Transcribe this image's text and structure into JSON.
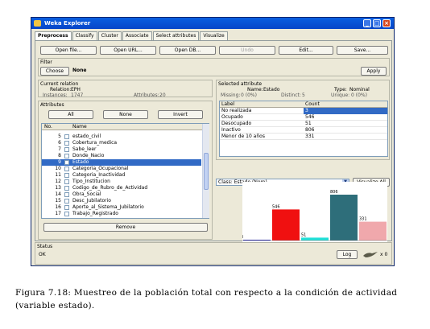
{
  "window": {
    "title": "Weka Explorer",
    "buttons": [
      "_",
      "□",
      "×"
    ]
  },
  "tabs": [
    "Preprocess",
    "Classify",
    "Cluster",
    "Associate",
    "Select attributes",
    "Visualize"
  ],
  "toolbar": {
    "open_file": "Open file...",
    "open_url": "Open URL...",
    "open_db": "Open DB...",
    "undo": "Undo",
    "edit": "Edit...",
    "save": "Save..."
  },
  "filter": {
    "title": "Filter",
    "choose": "Choose",
    "value": "None",
    "apply": "Apply"
  },
  "current_relation": {
    "title": "Current relation",
    "relation_label": "Relation:",
    "relation_value": "EPH",
    "instances_label": "Instances:",
    "instances_value": "1747",
    "attributes_label": "Attributes:",
    "attributes_value": "20"
  },
  "attributes": {
    "title": "Attributes",
    "buttons": {
      "all": "All",
      "none": "None",
      "invert": "Invert"
    },
    "header": {
      "no": "No.",
      "name": "Name"
    },
    "rows": [
      {
        "no": "5",
        "name": "estado_civil",
        "selected": false
      },
      {
        "no": "6",
        "name": "Cobertura_medica",
        "selected": false
      },
      {
        "no": "7",
        "name": "Sabe_leer",
        "selected": false
      },
      {
        "no": "8",
        "name": "Donde_Nacio",
        "selected": false
      },
      {
        "no": "9",
        "name": "Estado",
        "selected": true
      },
      {
        "no": "10",
        "name": "Categoria_Ocupacional",
        "selected": false
      },
      {
        "no": "11",
        "name": "Categoria_Inactividad",
        "selected": false
      },
      {
        "no": "12",
        "name": "Tipo_Institucion",
        "selected": false
      },
      {
        "no": "13",
        "name": "Codigo_de_Rubro_de_Actividad",
        "selected": false
      },
      {
        "no": "14",
        "name": "Obra_Social",
        "selected": false
      },
      {
        "no": "15",
        "name": "Desc_Jubilatorio",
        "selected": false
      },
      {
        "no": "16",
        "name": "Aporte_al_Sistema_Jubilatorio",
        "selected": false
      },
      {
        "no": "17",
        "name": "Trabajo_Registrado",
        "selected": false
      }
    ],
    "remove": "Remove"
  },
  "selected_attribute": {
    "title": "Selected attribute",
    "name_label": "Name:",
    "name_value": "Estado",
    "type_label": "Type:",
    "type_value": "Nominal",
    "missing_label": "Missing:",
    "missing_value": "0 (0%)",
    "distinct_label": "Distinct:",
    "distinct_value": "5",
    "unique_label": "Unique:",
    "unique_value": "0 (0%)",
    "table_header": {
      "label": "Label",
      "count": "Count"
    },
    "table_rows": [
      {
        "label": "No realizada",
        "count": "3",
        "selected": true
      },
      {
        "label": "Ocupado",
        "count": "546",
        "selected": false
      },
      {
        "label": "Desocupado",
        "count": "51",
        "selected": false
      },
      {
        "label": "Inactivo",
        "count": "806",
        "selected": false
      },
      {
        "label": "Menor de 10 años",
        "count": "331",
        "selected": false
      }
    ]
  },
  "class_select": {
    "value": "Class: Estado (Nom)",
    "visualize_all": "Visualize All"
  },
  "chart_data": {
    "type": "bar",
    "categories": [
      "No realizada",
      "Ocupado",
      "Desocupado",
      "Inactivo",
      "Menor de 10 años"
    ],
    "values": [
      3,
      546,
      51,
      806,
      331
    ],
    "data_labels": [
      "3",
      "546",
      "51",
      "806",
      "331"
    ],
    "colors": [
      "#1a1ab0",
      "#f01010",
      "#21e0d8",
      "#2e6e7a",
      "#f0a8ac"
    ],
    "ylim": [
      0,
      806
    ]
  },
  "status": {
    "title": "Status",
    "text": "OK",
    "log": "Log",
    "count": "x 0"
  },
  "caption": "Figura 7.18: Muestreo de la población total con respecto a la condición de actividad (variable estado)."
}
